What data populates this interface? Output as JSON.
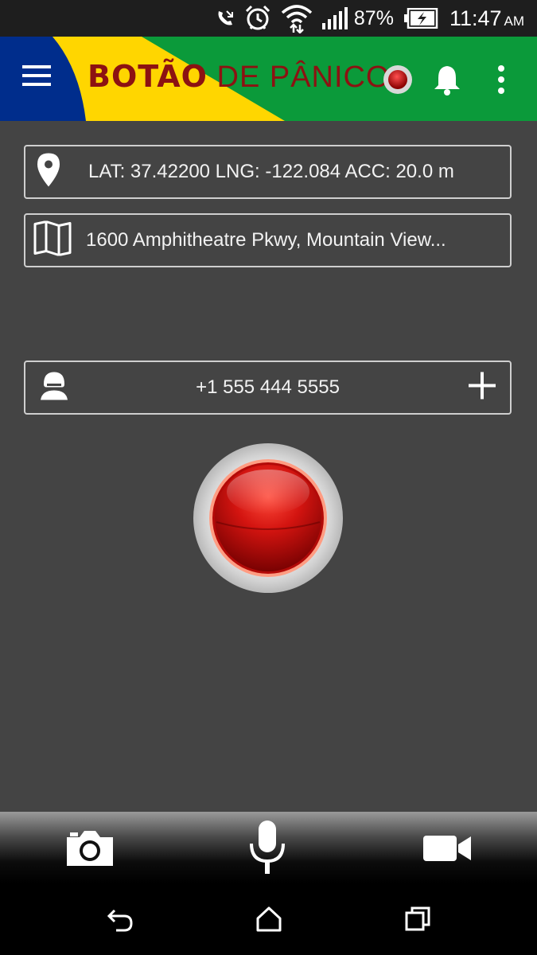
{
  "status_bar": {
    "battery_percent": "87%",
    "time": "11:47",
    "ampm": "AM",
    "icons": [
      "call-forward-icon",
      "alarm-clock-icon",
      "wifi-icon",
      "signal-icon",
      "battery-charging-icon"
    ]
  },
  "header": {
    "title_bold": "BOTÃO",
    "title_regular": "DE PÂNICO",
    "colors": {
      "blue": "#002d8c",
      "yellow": "#ffd600",
      "green": "#0b9a3a",
      "title": "#8c1212"
    }
  },
  "location": {
    "icon": "map-pin-icon",
    "text": "LAT: 37.42200 LNG: -122.084  ACC: 20.0 m"
  },
  "address": {
    "icon": "map-icon",
    "text": "1600 Amphitheatre Pkwy, Mountain View..."
  },
  "contact": {
    "icon": "person-icon",
    "phone": "+1 555 444 5555",
    "add_icon": "plus-icon"
  },
  "panic_button": {
    "color": "#d01818"
  },
  "media_bar": [
    "camera-icon",
    "microphone-icon",
    "video-camera-icon"
  ],
  "nav_bar": [
    "back-icon",
    "home-icon",
    "recents-icon"
  ]
}
